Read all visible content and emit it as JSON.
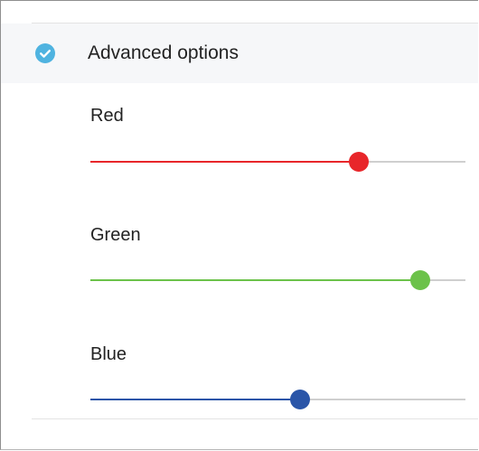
{
  "header": {
    "title": "Advanced options",
    "checked": true,
    "check_color": "#4fb3e0",
    "icon": "check-circle-icon"
  },
  "sliders": [
    {
      "label": "Red",
      "value": 0.715,
      "color": "#e8262a"
    },
    {
      "label": "Green",
      "value": 0.88,
      "color": "#6cc24a"
    },
    {
      "label": "Blue",
      "value": 0.56,
      "color": "#2a55a8"
    }
  ]
}
